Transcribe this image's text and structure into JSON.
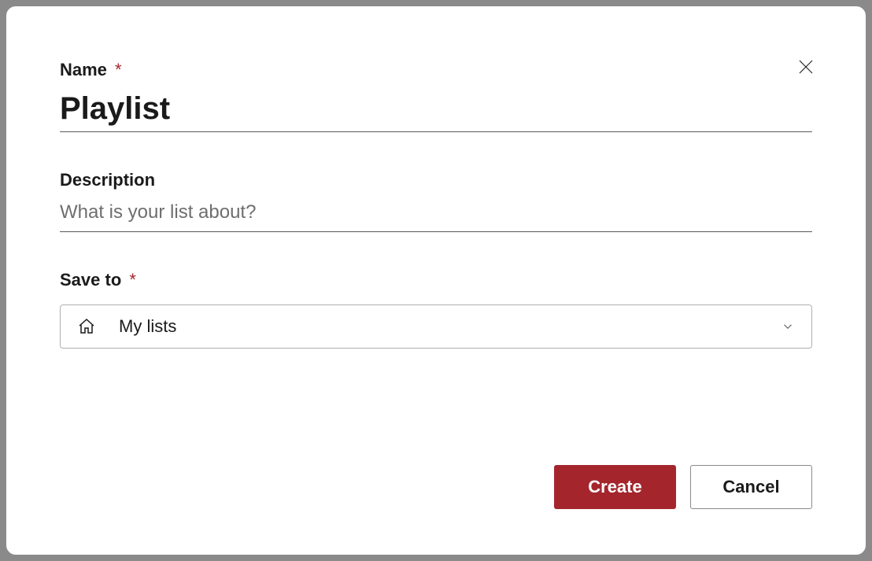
{
  "fields": {
    "name": {
      "label": "Name",
      "value": "Playlist"
    },
    "description": {
      "label": "Description",
      "placeholder": "What is your list about?",
      "value": ""
    },
    "save_to": {
      "label": "Save to",
      "selected": "My lists"
    }
  },
  "required_marker": "*",
  "buttons": {
    "create": "Create",
    "cancel": "Cancel"
  },
  "colors": {
    "accent": "#a4262c"
  }
}
